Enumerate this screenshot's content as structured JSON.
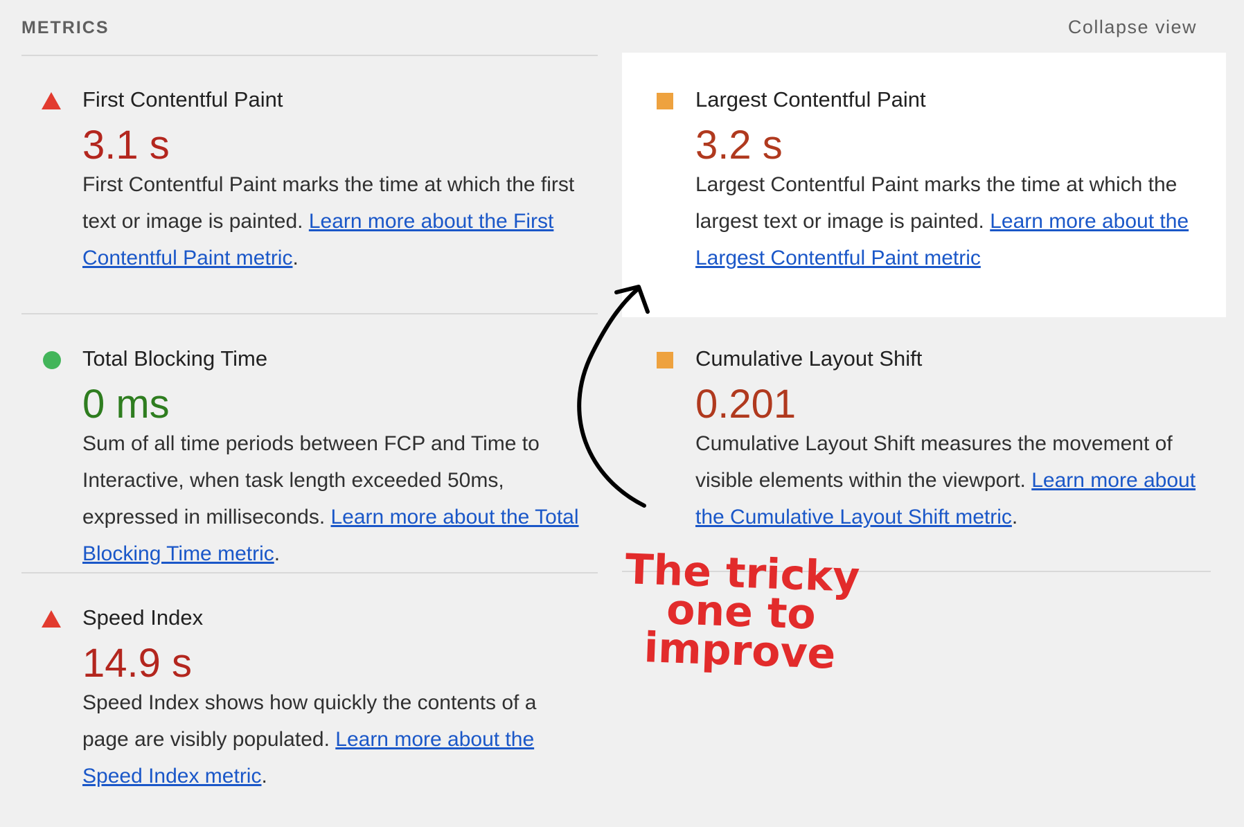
{
  "header": {
    "title": "METRICS",
    "collapse_label": "Collapse view"
  },
  "metrics": [
    {
      "title": "First Contentful Paint",
      "value": "3.1 s",
      "status": "poor",
      "icon": "red-triangle-icon",
      "desc": "First Contentful Paint marks the time at which the first text or image is painted.",
      "link": "Learn more about the First Contentful Paint metric",
      "after": "."
    },
    {
      "title": "Largest Contentful Paint",
      "value": "3.2 s",
      "status": "needs-improvement",
      "icon": "orange-square-icon",
      "desc": "Largest Contentful Paint marks the time at which the largest text or image is painted.",
      "link": "Learn more about the Largest Contentful Paint metric",
      "after": ""
    },
    {
      "title": "Total Blocking Time",
      "value": "0 ms",
      "status": "good",
      "icon": "green-circle-icon",
      "desc": "Sum of all time periods between FCP and Time to Interactive, when task length exceeded 50ms, expressed in milliseconds.",
      "link": "Learn more about the Total Blocking Time metric",
      "after": "."
    },
    {
      "title": "Cumulative Layout Shift",
      "value": "0.201",
      "status": "needs-improvement",
      "icon": "orange-square-icon",
      "desc": "Cumulative Layout Shift measures the movement of visible elements within the viewport.",
      "link": "Learn more about the Cumulative Layout Shift metric",
      "after": "."
    },
    {
      "title": "Speed Index",
      "value": "14.9 s",
      "status": "poor",
      "icon": "red-triangle-icon",
      "desc": "Speed Index shows how quickly the contents of a page are visibly populated.",
      "link": "Learn more about the Speed Index metric",
      "after": "."
    }
  ],
  "annotation": {
    "text": "The tricky one to improve",
    "color": "#e22b2b"
  },
  "colors": {
    "poor": "#e23b2f",
    "needs_improvement": "#eea23f",
    "good": "#43b55a",
    "link": "#1a57c8"
  }
}
